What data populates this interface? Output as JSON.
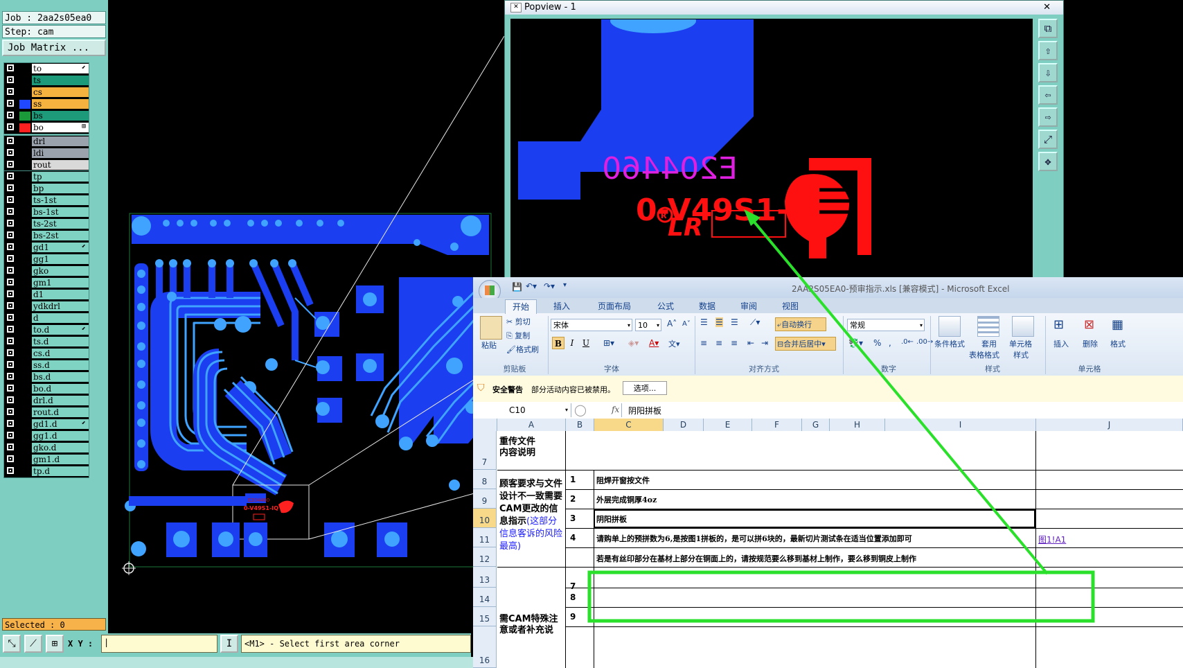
{
  "cam": {
    "job_label": "Job : 2aa2s05ea0",
    "step_label": "Step: cam",
    "job_matrix_label": "Job Matrix ...",
    "selected_label": "Selected : 0",
    "xy_label": "X Y :",
    "status_message": "<M1> - Select first area corner",
    "layers_board": [
      {
        "name": "to",
        "color": "#ffffff",
        "mark": "⬋"
      },
      {
        "name": "ts",
        "color": "#1c9a7a",
        "mark": ""
      },
      {
        "name": "cs",
        "color": "#f5b23e",
        "mark": ""
      },
      {
        "name": "ss",
        "color": "#f5b23e",
        "mark": ""
      },
      {
        "name": "bs",
        "color": "#1c9a7a",
        "mark": ""
      },
      {
        "name": "bo",
        "color": "#ffffff",
        "mark": "⊞"
      }
    ],
    "layers_drill": [
      {
        "name": "drl",
        "color": "#9aa3ad",
        "mark": ""
      },
      {
        "name": "ldi",
        "color": "#9aa3ad",
        "mark": ""
      },
      {
        "name": "rout",
        "color": "#d9d9d9",
        "mark": ""
      }
    ],
    "layers_misc": [
      {
        "name": "tp",
        "mark": ""
      },
      {
        "name": "bp",
        "mark": ""
      },
      {
        "name": "ts-1st",
        "mark": ""
      },
      {
        "name": "bs-1st",
        "mark": ""
      },
      {
        "name": "ts-2st",
        "mark": ""
      },
      {
        "name": "bs-2st",
        "mark": ""
      },
      {
        "name": "gd1",
        "mark": "⬋"
      },
      {
        "name": "gg1",
        "mark": ""
      },
      {
        "name": "gko",
        "mark": ""
      },
      {
        "name": "gm1",
        "mark": ""
      },
      {
        "name": "d1",
        "mark": ""
      },
      {
        "name": "ydkdrl",
        "mark": ""
      },
      {
        "name": "d",
        "mark": ""
      },
      {
        "name": "to.d",
        "mark": "⬋"
      },
      {
        "name": "ts.d",
        "mark": ""
      },
      {
        "name": "cs.d",
        "mark": ""
      },
      {
        "name": "ss.d",
        "mark": ""
      },
      {
        "name": "bs.d",
        "mark": ""
      },
      {
        "name": "bo.d",
        "mark": ""
      },
      {
        "name": "drl.d",
        "mark": ""
      },
      {
        "name": "rout.d",
        "mark": ""
      },
      {
        "name": "gd1.d",
        "mark": "⬋"
      },
      {
        "name": "gg1.d",
        "mark": ""
      },
      {
        "name": "gko.d",
        "mark": ""
      },
      {
        "name": "gm1.d",
        "mark": ""
      },
      {
        "name": "tp.d",
        "mark": ""
      }
    ]
  },
  "popview": {
    "title": "Popview - 1",
    "silk_text_top": "E204460",
    "silk_text_main": "0-V49S1-IQ",
    "logo_text": "LR"
  },
  "excel": {
    "window_title": "2AA2S05EA0-预审指示.xls [兼容模式] - Microsoft Excel",
    "tabs": [
      "开始",
      "插入",
      "页面布局",
      "公式",
      "数据",
      "审阅",
      "视图"
    ],
    "clipboard": {
      "paste": "粘贴",
      "cut": "剪切",
      "copy": "复制",
      "format_painter": "格式刷",
      "group": "剪贴板"
    },
    "font": {
      "name": "宋体",
      "size": "10",
      "bold": "B",
      "italic": "I",
      "underline": "U",
      "group": "字体"
    },
    "alignment": {
      "wrap": "自动换行",
      "merge": "合并后居中",
      "group": "对齐方式"
    },
    "number": {
      "format": "常规",
      "percent": "%",
      "comma": ",",
      "group": "数字"
    },
    "styles": {
      "conditional": "条件格式",
      "table_line1": "套用",
      "table_line2": "表格格式",
      "cell_line1": "单元格",
      "cell_line2": "样式",
      "group": "样式"
    },
    "cells": {
      "insert": "插入",
      "delete": "删除",
      "format": "格式",
      "group": "单元格"
    },
    "security": {
      "title": "安全警告",
      "message": "部分活动内容已被禁用。",
      "options": "选项..."
    },
    "formula_bar": {
      "name_box": "C10",
      "fx": "fx",
      "content": "阴阳拼板"
    },
    "columns": [
      "A",
      "B",
      "C",
      "D",
      "E",
      "F",
      "G",
      "H",
      "I",
      "J"
    ],
    "rows": [
      "7",
      "8",
      "9",
      "10",
      "11",
      "12",
      "13",
      "14",
      "15",
      "16"
    ],
    "section1": "重传文件\n内容说明",
    "section2_black": "顾客要求与文件设计不一致需要CAM更改的信息指示",
    "section2_blue": "(这部分信息客诉的风险最高)",
    "section3": "需CAM特殊注意或者补充说",
    "items": [
      {
        "num": "1",
        "text": "阻焊开窗按文件"
      },
      {
        "num": "2",
        "text": "外层完成铜厚4oz"
      },
      {
        "num": "3",
        "text": "阴阳拼板"
      },
      {
        "num": "4",
        "text": "请购单上的预拼数为6,是按图1拼板的，是可以拼6块的，最新切片测试条在适当位置添加即可"
      },
      {
        "num": "",
        "text": "若是有丝印部分在基材上部分在铜面上的，请按规范要么移到基材上制作，要么移到铜皮上制作"
      },
      {
        "num": "7",
        "text": ""
      },
      {
        "num": "8",
        "text": ""
      },
      {
        "num": "9",
        "text": ""
      }
    ],
    "link_text": "图1!A1"
  }
}
